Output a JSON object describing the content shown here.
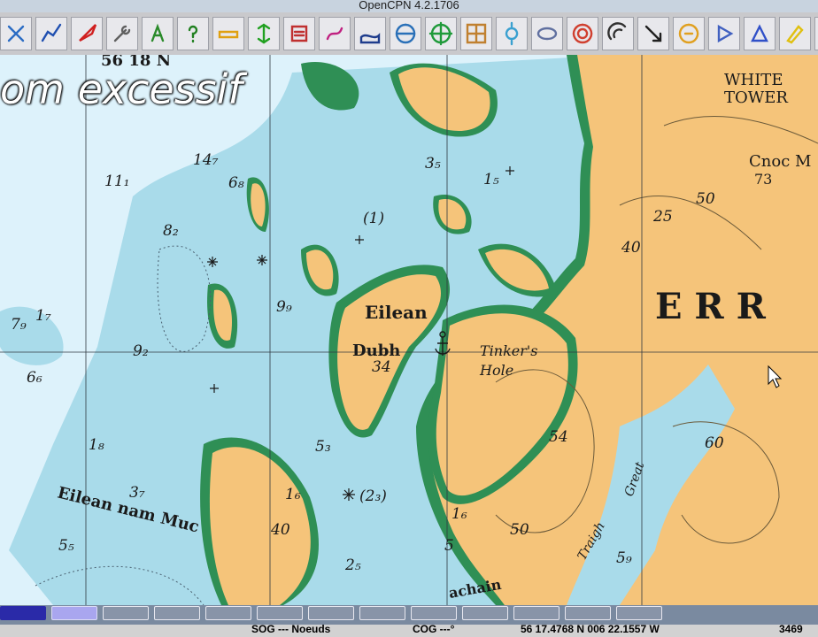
{
  "window": {
    "title": "OpenCPN 4.2.1706"
  },
  "toolbar": {
    "tools": [
      {
        "icon": "zoom-icon",
        "color": "#2b6cc4"
      },
      {
        "icon": "route-icon",
        "color": "#1f4fb0"
      },
      {
        "icon": "rocket-icon",
        "color": "#d02020"
      },
      {
        "icon": "settings-wrench-icon",
        "color": "#606060"
      },
      {
        "icon": "text-icon",
        "color": "#2a8a2a"
      },
      {
        "icon": "help-question-icon",
        "color": "#208020"
      },
      {
        "icon": "ruler-icon",
        "color": "#e0a010"
      },
      {
        "icon": "vertical-measure-icon",
        "color": "#20a020"
      },
      {
        "icon": "checklist-icon",
        "color": "#c03030"
      },
      {
        "icon": "track-icon",
        "color": "#c02080"
      },
      {
        "icon": "chart-tide-icon",
        "color": "#1e3c8c"
      },
      {
        "icon": "globe-icon",
        "color": "#2a70b8"
      },
      {
        "icon": "crosshair-icon",
        "color": "#1f9a3a"
      },
      {
        "icon": "mosaic-icon",
        "color": "#c08030"
      },
      {
        "icon": "settings-icon",
        "color": "#3aa0d0"
      },
      {
        "icon": "compass-icon",
        "color": "#6070a0"
      },
      {
        "icon": "lifering-icon",
        "color": "#d04030"
      },
      {
        "icon": "radar-icon",
        "color": "#303030"
      },
      {
        "icon": "arrow-icon",
        "color": "#202020"
      },
      {
        "icon": "tide-icon",
        "color": "#e0a020"
      },
      {
        "icon": "play-icon",
        "color": "#4060c0"
      },
      {
        "icon": "triangle-icon",
        "color": "#3050c8"
      },
      {
        "icon": "pencil-icon",
        "color": "#e0c010"
      },
      {
        "icon": "tf-icon",
        "color": "#2060c0"
      }
    ]
  },
  "chart": {
    "banner_text": "om excessif",
    "labels": {
      "lat_label": "56 18 N",
      "eilean": "Eilean",
      "dubh": "Dubh",
      "tinkers": "Tinker's",
      "hole": "Hole",
      "white": "WHITE",
      "tower": "TOWER",
      "cnoc": "Cnoc M",
      "cnoc_height": "73",
      "err": "E R R",
      "eilean_nam_muc": "Eilean nam Muc",
      "traigh": "Traigh",
      "great": "Great",
      "achain": "achain"
    },
    "soundings": [
      {
        "v": "14₇"
      },
      {
        "v": "11₁"
      },
      {
        "v": "9₂"
      },
      {
        "v": "7₉"
      },
      {
        "v": "9₉"
      },
      {
        "v": "6₆"
      },
      {
        "v": "1₈"
      },
      {
        "v": "1₇"
      },
      {
        "v": "8₂"
      },
      {
        "v": "6₈"
      },
      {
        "v": "5₃"
      },
      {
        "v": "1₆"
      },
      {
        "v": "3₇"
      },
      {
        "v": "5₅"
      },
      {
        "v": "2₅"
      },
      {
        "v": "3₅"
      },
      {
        "v": "1₅"
      },
      {
        "v": "(1)"
      },
      {
        "v": "(2₃)"
      },
      {
        "v": "40"
      },
      {
        "v": "34"
      },
      {
        "v": "54"
      },
      {
        "v": "60"
      },
      {
        "v": "50"
      },
      {
        "v": "25"
      },
      {
        "v": "40"
      },
      {
        "v": "50"
      },
      {
        "v": "1₆"
      },
      {
        "v": "5"
      },
      {
        "v": "5₉"
      }
    ]
  },
  "piano": {
    "keys": 13
  },
  "status": {
    "sog": "SOG --- Noeuds",
    "cog": "COG ---°",
    "position": "56 17.4768 N   006 22.1557 W",
    "extra": "3469"
  }
}
